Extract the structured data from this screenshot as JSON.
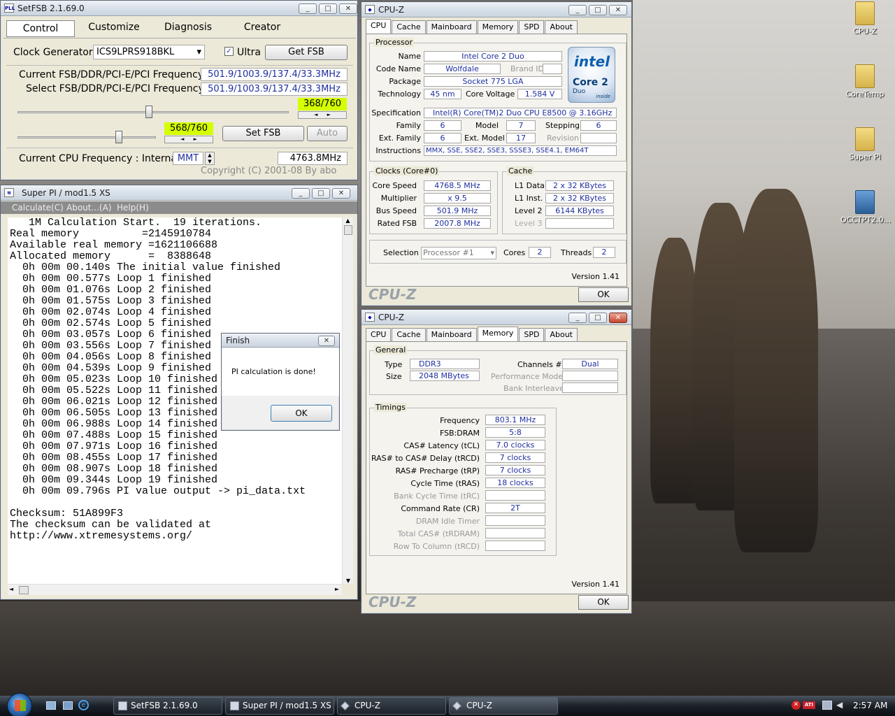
{
  "setfsb": {
    "title": "SetFSB 2.1.69.0",
    "tabs": [
      "Control",
      "Customize",
      "Diagnosis",
      "Creator"
    ],
    "clock_label": "Clock Generator",
    "clock_value": "ICS9LPRS918BKL",
    "ultra": "Ultra",
    "get_fsb": "Get FSB",
    "current_label": "Current FSB/DDR/PCI-E/PCI Frequency",
    "current_value": "501.9/1003.9/137.4/33.3MHz",
    "select_label": "Select FSB/DDR/PCI-E/PCI Frequency",
    "select_value": "501.9/1003.9/137.4/33.3MHz",
    "slider1_value": "368/760",
    "slider1_fraction": 0.484,
    "slider2_value": "568/760",
    "slider2_fraction": 0.747,
    "set_fsb": "Set FSB",
    "auto": "Auto",
    "cpu_label": "Current CPU Frequency : Internal",
    "mmt": "MMT",
    "cpu_value": "4763.8MHz",
    "copyright": "Copyright (C) 2001-08 By abo"
  },
  "superpi": {
    "title": "Super PI / mod1.5 XS",
    "menu": [
      "Calculate(C)",
      "About...(A)",
      "Help(H)"
    ],
    "lines": [
      "   1M Calculation Start.  19 iterations.",
      "Real memory          =2145910784",
      "Available real memory =1621106688",
      "Allocated memory      =  8388648",
      "  0h 00m 00.140s The initial value finished",
      "  0h 00m 00.577s Loop 1 finished",
      "  0h 00m 01.076s Loop 2 finished",
      "  0h 00m 01.575s Loop 3 finished",
      "  0h 00m 02.074s Loop 4 finished",
      "  0h 00m 02.574s Loop 5 finished",
      "  0h 00m 03.057s Loop 6 finished",
      "  0h 00m 03.556s Loop 7 finished",
      "  0h 00m 04.056s Loop 8 finished",
      "  0h 00m 04.539s Loop 9 finished",
      "  0h 00m 05.023s Loop 10 finished",
      "  0h 00m 05.522s Loop 11 finished",
      "  0h 00m 06.021s Loop 12 finished",
      "  0h 00m 06.505s Loop 13 finished",
      "  0h 00m 06.988s Loop 14 finished",
      "  0h 00m 07.488s Loop 15 finished",
      "  0h 00m 07.971s Loop 16 finished",
      "  0h 00m 08.455s Loop 17 finished",
      "  0h 00m 08.907s Loop 18 finished",
      "  0h 00m 09.344s Loop 19 finished",
      "  0h 00m 09.796s PI value output -> pi_data.txt",
      "",
      "Checksum: 51A899F3",
      "The checksum can be validated at",
      "http://www.xtremesystems.org/"
    ]
  },
  "finish": {
    "title": "Finish",
    "message": "PI calculation is done!",
    "ok": "OK"
  },
  "cpuz1": {
    "title": "CPU-Z",
    "tabs": [
      "CPU",
      "Cache",
      "Mainboard",
      "Memory",
      "SPD",
      "About"
    ],
    "processor": "Processor",
    "name_l": "Name",
    "name": "Intel Core 2 Duo",
    "code_l": "Code Name",
    "code": "Wolfdale",
    "brand_l": "Brand ID",
    "package_l": "Package",
    "package": "Socket 775 LGA",
    "tech_l": "Technology",
    "tech": "45 nm",
    "volt_l": "Core Voltage",
    "volt": "1.584 V",
    "spec_l": "Specification",
    "spec": "Intel(R) Core(TM)2 Duo CPU     E8500  @ 3.16GHz",
    "family_l": "Family",
    "family": "6",
    "model_l": "Model",
    "model": "7",
    "stepping_l": "Stepping",
    "stepping": "6",
    "extfam_l": "Ext. Family",
    "extfam": "6",
    "extmod_l": "Ext. Model",
    "extmod": "17",
    "revision_l": "Revision",
    "instr_l": "Instructions",
    "instr": "MMX, SSE, SSE2, SSE3, SSSE3, SSE4.1, EM64T",
    "clocks": "Clocks (Core#0)",
    "speed_l": "Core Speed",
    "speed": "4768.5 MHz",
    "mult_l": "Multiplier",
    "mult": "x 9.5",
    "bus_l": "Bus Speed",
    "bus": "501.9 MHz",
    "fsb_l": "Rated FSB",
    "fsb": "2007.8 MHz",
    "cache": "Cache",
    "l1d_l": "L1 Data",
    "l1d": "2 x 32 KBytes",
    "l1i_l": "L1 Inst.",
    "l1i": "2 x 32 KBytes",
    "l2_l": "Level 2",
    "l2": "6144 KBytes",
    "l3_l": "Level 3",
    "sel_l": "Selection",
    "sel": "Processor #1",
    "cores_l": "Cores",
    "cores": "2",
    "threads_l": "Threads",
    "threads": "2",
    "version": "Version 1.41",
    "logo": "CPU-Z",
    "ok": "OK",
    "intel": {
      "brand": "intel",
      "line": "Core 2",
      "sub": "Duo",
      "inside": "inside"
    }
  },
  "cpuz2": {
    "title": "CPU-Z",
    "tabs": [
      "CPU",
      "Cache",
      "Mainboard",
      "Memory",
      "SPD",
      "About"
    ],
    "general": "General",
    "type_l": "Type",
    "type": "DDR3",
    "size_l": "Size",
    "size": "2048 MBytes",
    "chan_l": "Channels #",
    "chan": "Dual",
    "perf_l": "Performance Mode",
    "bank_l": "Bank Interleave",
    "timings": "Timings",
    "freq_l": "Frequency",
    "freq": "803.1 MHz",
    "fsbdram_l": "FSB:DRAM",
    "fsbdram": "5:8",
    "cas_l": "CAS# Latency (tCL)",
    "cas": "7.0 clocks",
    "rcd_l": "RAS# to CAS# Delay (tRCD)",
    "rcd": "7 clocks",
    "rp_l": "RAS# Precharge (tRP)",
    "rp": "7 clocks",
    "ras_l": "Cycle Time (tRAS)",
    "ras": "18 clocks",
    "rc_l": "Bank Cycle Time (tRC)",
    "cr_l": "Command Rate (CR)",
    "cr": "2T",
    "idle_l": "DRAM Idle Timer",
    "trdram_l": "Total CAS# (tRDRAM)",
    "trcd2_l": "Row To Column (tRCD)",
    "version": "Version 1.41",
    "logo": "CPU-Z",
    "ok": "OK"
  },
  "desktop": {
    "icons": [
      "CPU-Z",
      "CoreTemp",
      "Super PI",
      "OCCTPT2.0..."
    ]
  },
  "taskbar": {
    "items": [
      "SetFSB 2.1.69.0",
      "Super PI / mod1.5 XS",
      "CPU-Z",
      "CPU-Z"
    ],
    "clock": "2:57 AM"
  }
}
